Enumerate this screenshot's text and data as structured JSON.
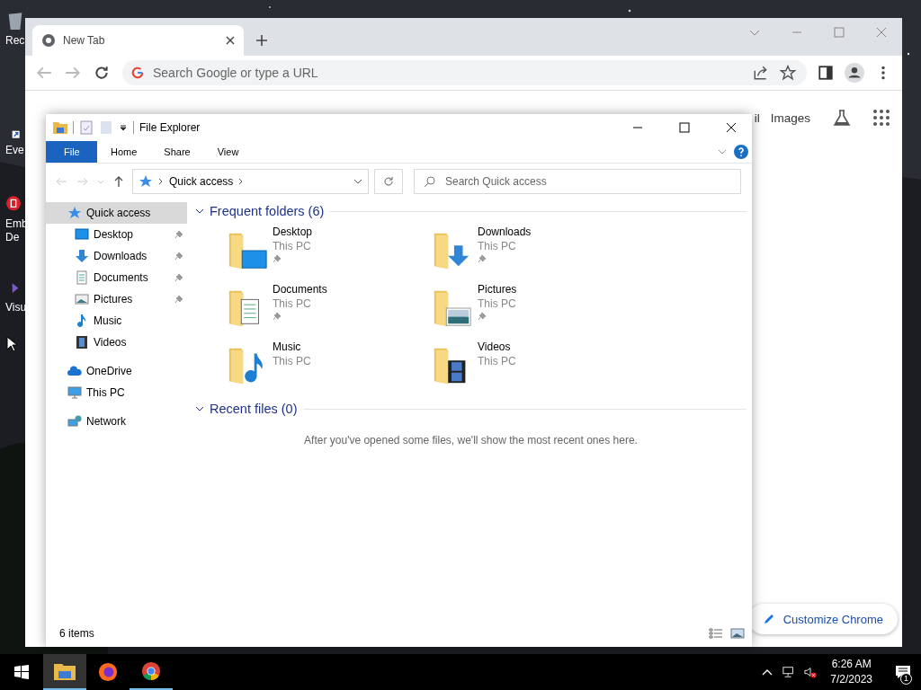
{
  "desktop": {
    "icons": [
      {
        "kind": "recycle",
        "lines": [
          "Rec"
        ]
      },
      {
        "kind": "shortcut",
        "lines": [
          "Eve"
        ]
      },
      {
        "kind": "red",
        "lines": [
          "Emb",
          "De"
        ]
      },
      {
        "kind": "purple",
        "lines": [
          "Visu"
        ]
      }
    ]
  },
  "chrome": {
    "tab": {
      "title": "New Tab"
    },
    "omnibox": {
      "placeholder": "Search Google or type a URL"
    },
    "links": [
      "il",
      "Images"
    ],
    "customize": "Customize Chrome"
  },
  "explorer": {
    "title": "File Explorer",
    "ribbon_tabs": [
      {
        "label": "File",
        "selected": true
      },
      {
        "label": "Home",
        "selected": false
      },
      {
        "label": "Share",
        "selected": false
      },
      {
        "label": "View",
        "selected": false
      }
    ],
    "address": "Quick access",
    "search": {
      "placeholder": "Search Quick access"
    },
    "nav": [
      {
        "label": "Quick access",
        "kind": "star",
        "selected": true,
        "children": [
          {
            "label": "Desktop",
            "kind": "desktop",
            "pinned": true
          },
          {
            "label": "Downloads",
            "kind": "downloads",
            "pinned": true
          },
          {
            "label": "Documents",
            "kind": "documents",
            "pinned": true
          },
          {
            "label": "Pictures",
            "kind": "pictures",
            "pinned": true
          },
          {
            "label": "Music",
            "kind": "music",
            "pinned": false
          },
          {
            "label": "Videos",
            "kind": "videos",
            "pinned": false
          }
        ]
      },
      {
        "label": "OneDrive",
        "kind": "cloud",
        "selected": false
      },
      {
        "label": "This PC",
        "kind": "pc",
        "selected": false
      },
      {
        "label": "Network",
        "kind": "network",
        "selected": false
      }
    ],
    "frequent": {
      "title": "Frequent folders (6)",
      "expanded": true,
      "folders": [
        {
          "name": "Desktop",
          "location": "This PC",
          "kind": "desktop",
          "pinned": true
        },
        {
          "name": "Downloads",
          "location": "This PC",
          "kind": "downloads",
          "pinned": true
        },
        {
          "name": "Documents",
          "location": "This PC",
          "kind": "documents",
          "pinned": true
        },
        {
          "name": "Pictures",
          "location": "This PC",
          "kind": "pictures",
          "pinned": true
        },
        {
          "name": "Music",
          "location": "This PC",
          "kind": "music",
          "pinned": false
        },
        {
          "name": "Videos",
          "location": "This PC",
          "kind": "videos",
          "pinned": false
        }
      ]
    },
    "recent": {
      "title": "Recent files (0)",
      "expanded": true,
      "empty_message": "After you've opened some files, we'll show the most recent ones here."
    },
    "status": "6 items"
  },
  "taskbar": {
    "apps": [
      {
        "kind": "explorer",
        "selected": true,
        "running": true
      },
      {
        "kind": "firefox",
        "selected": false,
        "running": false
      },
      {
        "kind": "chrome",
        "selected": false,
        "running": true
      }
    ],
    "time": "6:26 AM",
    "date": "7/2/2023",
    "notifications": "1"
  }
}
